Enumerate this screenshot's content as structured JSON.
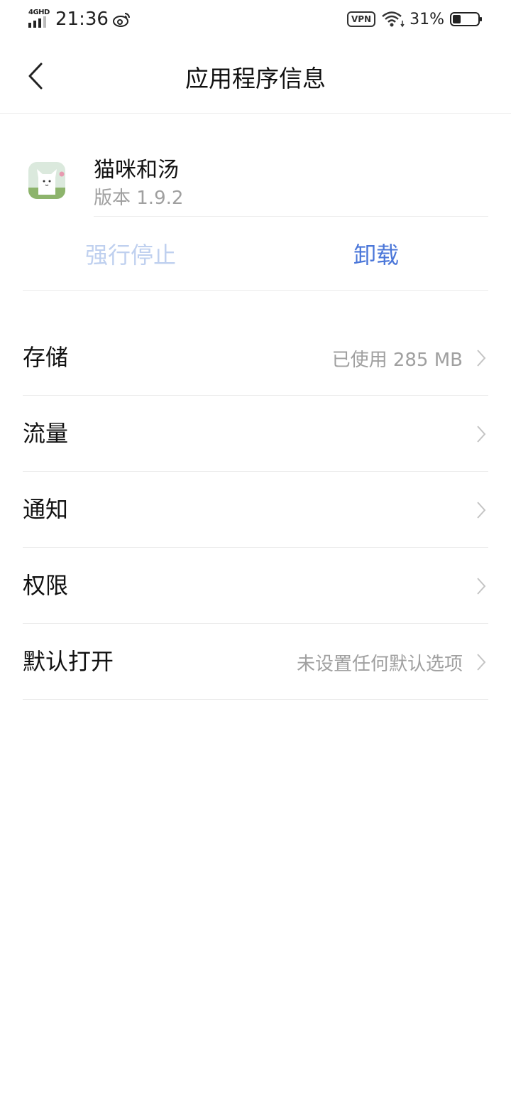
{
  "status_bar": {
    "network": "4GHD",
    "time": "21:36",
    "vpn": "VPN",
    "battery_percent": "31%",
    "battery_level": 0.31,
    "icons": [
      "signal-icon",
      "weibo-icon",
      "vpn-icon",
      "wifi-icon",
      "battery-icon"
    ]
  },
  "header": {
    "title": "应用程序信息",
    "back_icon": "back-arrow-icon"
  },
  "app": {
    "name": "猫咪和汤",
    "version": "版本  1.9.2",
    "icon": "cat-app-icon"
  },
  "actions": {
    "force_stop": "强行停止",
    "force_stop_enabled": false,
    "uninstall": "卸载",
    "accent_color": "#4a76d9",
    "disabled_color": "#bfd0ef"
  },
  "settings": [
    {
      "label": "存储",
      "value": "已使用  285  MB"
    },
    {
      "label": "流量",
      "value": ""
    },
    {
      "label": "通知",
      "value": ""
    },
    {
      "label": "权限",
      "value": ""
    },
    {
      "label": "默认打开",
      "value": "未设置任何默认选项"
    }
  ]
}
